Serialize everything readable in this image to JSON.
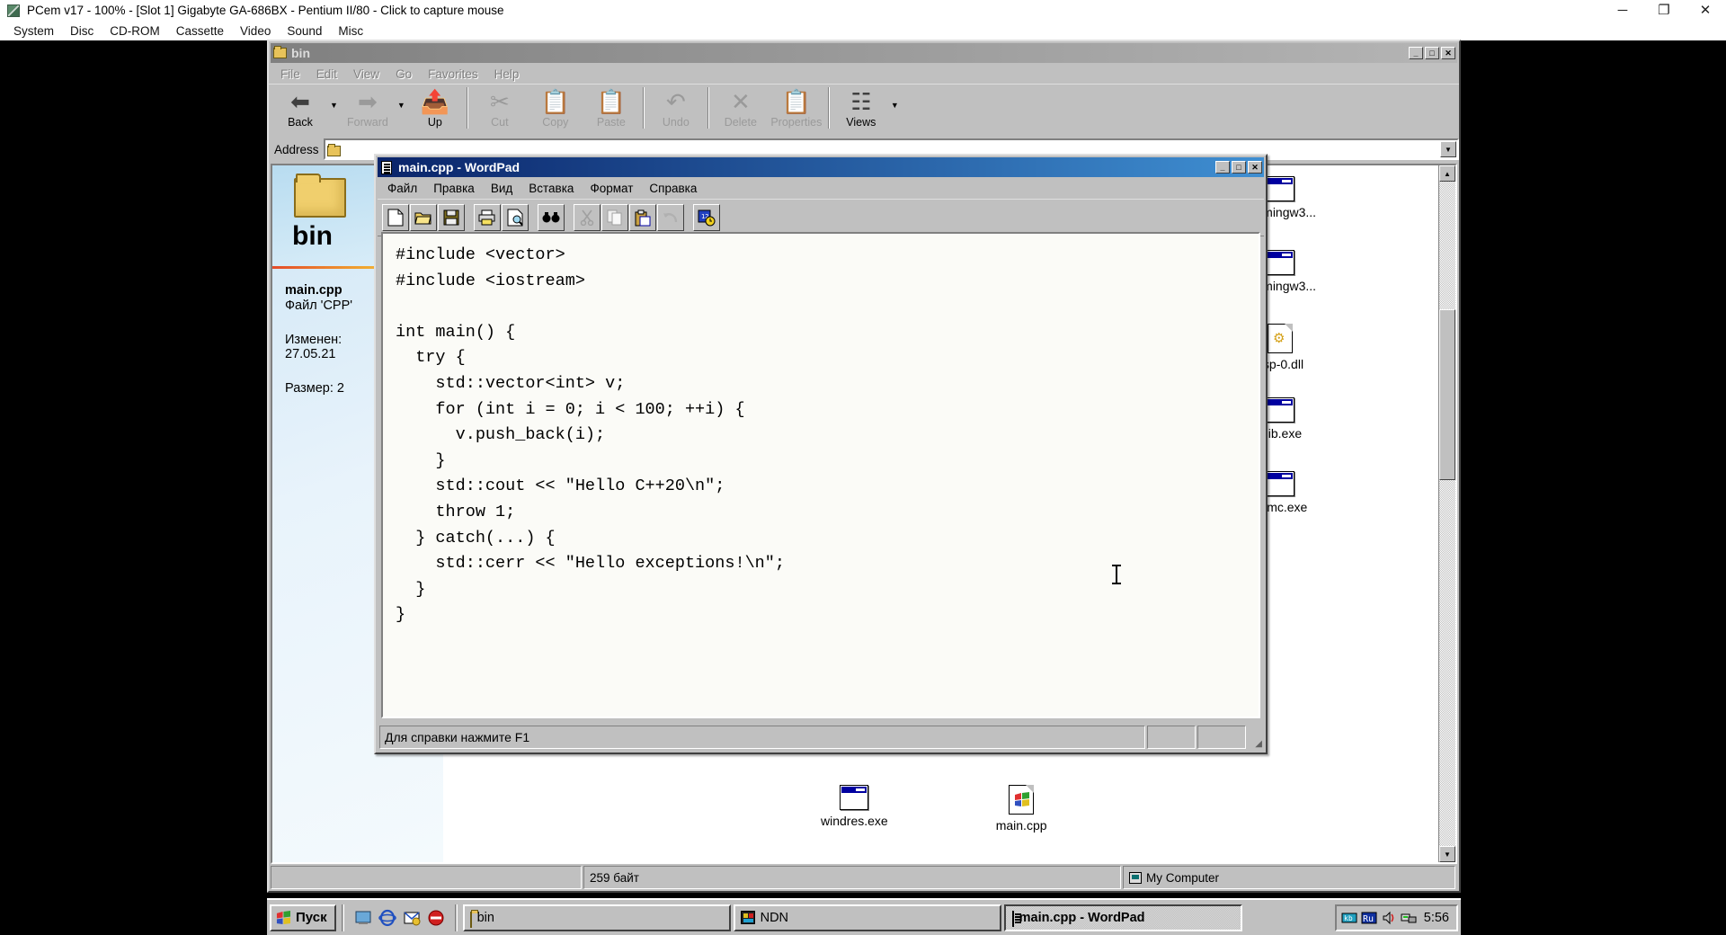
{
  "host": {
    "title": "PCem v17 - 100% - [Slot 1] Gigabyte GA-686BX - Pentium II/80 - Click to capture mouse",
    "app_icon": "pcem-icon",
    "menu": [
      "System",
      "Disc",
      "CD-ROM",
      "Cassette",
      "Video",
      "Sound",
      "Misc"
    ],
    "window_buttons": {
      "minimize": "─",
      "maximize": "❐",
      "close": "✕"
    }
  },
  "explorer": {
    "title": "bin",
    "title_icon": "folder-icon",
    "active": false,
    "window_buttons": {
      "minimize": "_",
      "maximize": "□",
      "close": "✕"
    },
    "menu": [
      "File",
      "Edit",
      "View",
      "Go",
      "Favorites",
      "Help"
    ],
    "toolbar": [
      {
        "label": "Back",
        "icon": "back-arrow-icon",
        "disabled": false,
        "dropdown": true
      },
      {
        "label": "Forward",
        "icon": "forward-arrow-icon",
        "disabled": true,
        "dropdown": true
      },
      {
        "label": "Up",
        "icon": "up-folder-icon",
        "disabled": false,
        "dropdown": false
      },
      {
        "label": "Cut",
        "icon": "scissors-icon",
        "disabled": true,
        "dropdown": false
      },
      {
        "label": "Copy",
        "icon": "copy-icon",
        "disabled": true,
        "dropdown": false
      },
      {
        "label": "Paste",
        "icon": "clipboard-paste-icon",
        "disabled": true,
        "dropdown": false
      },
      {
        "label": "Undo",
        "icon": "undo-arrow-icon",
        "disabled": true,
        "dropdown": false
      },
      {
        "label": "Delete",
        "icon": "delete-x-icon",
        "disabled": true,
        "dropdown": false
      },
      {
        "label": "Properties",
        "icon": "properties-icon",
        "disabled": true,
        "dropdown": false
      },
      {
        "label": "Views",
        "icon": "views-icon",
        "disabled": false,
        "dropdown": true
      }
    ],
    "address": {
      "label": "Address",
      "value": "",
      "icon": "folder-icon",
      "dropdown_icon": "chevron-down-icon"
    },
    "webview": {
      "folder_name": "bin",
      "file_name": "main.cpp",
      "file_type": "Файл 'CPP'",
      "modified_label": "Изменен:",
      "modified_value": "27.05.21",
      "size_label": "Размер: 2"
    },
    "files_column": [
      {
        "label": "64-mingw3...",
        "icon": "exe-icon"
      },
      {
        "label": "64-mingw3...",
        "icon": "exe-icon"
      },
      {
        "label": "ssp-0.dll",
        "icon": "dll-icon"
      },
      {
        "label": "nlib.exe",
        "icon": "exe-icon"
      },
      {
        "label": "ndmc.exe",
        "icon": "exe-icon"
      }
    ],
    "files_bottom": [
      {
        "label": "windres.exe",
        "icon": "exe-icon"
      },
      {
        "label": "main.cpp",
        "icon": "cpp-file-icon"
      }
    ],
    "status": {
      "left": "",
      "middle": "259 байт",
      "right": "My Computer",
      "right_icon": "my-computer-icon"
    }
  },
  "wordpad": {
    "title": "main.cpp - WordPad",
    "title_icon": "document-icon",
    "active": true,
    "window_buttons": {
      "minimize": "_",
      "maximize": "□",
      "close": "✕"
    },
    "menu": [
      "Файл",
      "Правка",
      "Вид",
      "Вставка",
      "Формат",
      "Справка"
    ],
    "toolbar": [
      {
        "name": "new-icon",
        "glyph": "⬜",
        "gap_after": false
      },
      {
        "name": "open-icon",
        "glyph": "📂",
        "gap_after": false
      },
      {
        "name": "save-icon",
        "glyph": "💾",
        "gap_after": true
      },
      {
        "name": "print-icon",
        "glyph": "🖨",
        "gap_after": false
      },
      {
        "name": "print-preview-icon",
        "glyph": "🔎",
        "gap_after": true
      },
      {
        "name": "find-icon",
        "glyph": "🔭",
        "gap_after": true
      },
      {
        "name": "cut-icon",
        "glyph": "✂",
        "gap_after": false
      },
      {
        "name": "copy-icon",
        "glyph": "❐",
        "gap_after": false
      },
      {
        "name": "paste-icon",
        "glyph": "📋",
        "gap_after": false
      },
      {
        "name": "undo-icon",
        "glyph": "↶",
        "gap_after": true
      },
      {
        "name": "date-time-icon",
        "glyph": "📅",
        "gap_after": false
      }
    ],
    "document_text": "#include <vector>\n#include <iostream>\n\nint main() {\n  try {\n    std::vector<int> v;\n    for (int i = 0; i < 100; ++i) {\n      v.push_back(i);\n    }\n    std::cout << \"Hello C++20\\n\";\n    throw 1;\n  } catch(...) {\n    std::cerr << \"Hello exceptions!\\n\";\n  }\n}",
    "status": {
      "text": "Для справки нажмите F1",
      "pane2": "",
      "pane3": ""
    }
  },
  "taskbar": {
    "start_label": "Пуск",
    "start_icon": "windows-flag-icon",
    "quicklaunch": [
      {
        "name": "show-desktop-icon"
      },
      {
        "name": "internet-explorer-icon"
      },
      {
        "name": "outlook-express-icon"
      },
      {
        "name": "media-player-icon"
      }
    ],
    "tasks": [
      {
        "label": "bin",
        "icon": "folder-icon",
        "active": false
      },
      {
        "label": "NDN",
        "icon": "ndn-icon",
        "active": false
      },
      {
        "label": "main.cpp - WordPad",
        "icon": "document-icon",
        "active": true
      }
    ],
    "tray_icons": [
      "keyboard-layout-icon",
      "ru-language-icon",
      "volume-icon",
      "network-icon"
    ],
    "clock": "5:56"
  },
  "colors": {
    "win98_face": "#c0c0c0",
    "title_active_left": "#0a246a",
    "title_active_right": "#3f8fd2",
    "title_inactive_left": "#808080",
    "desktop": "#000000",
    "webview_accent": "#e44b2a"
  }
}
